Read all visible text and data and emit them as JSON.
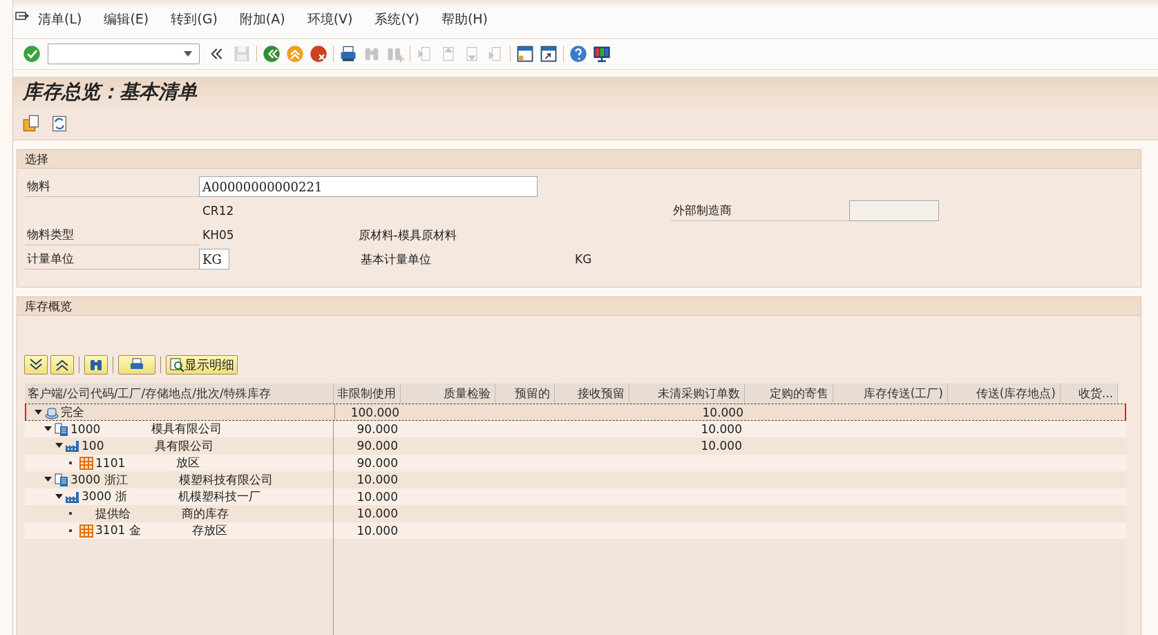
{
  "menu_bar": {
    "items": [
      {
        "label": "清单(L)"
      },
      {
        "label": "编辑(E)"
      },
      {
        "label": "转到(G)"
      },
      {
        "label": "附加(A)"
      },
      {
        "label": "环境(V)"
      },
      {
        "label": "系统(Y)"
      },
      {
        "label": "帮助(H)"
      }
    ]
  },
  "toolbar": {
    "buttons": [
      {
        "kind": "enter",
        "disabled": false
      },
      {
        "kind": "collapse",
        "disabled": false
      },
      {
        "kind": "save",
        "disabled": true
      },
      {
        "kind": "sep"
      },
      {
        "kind": "back",
        "disabled": false
      },
      {
        "kind": "exit",
        "disabled": false
      },
      {
        "kind": "cancel",
        "disabled": false
      },
      {
        "kind": "sep"
      },
      {
        "kind": "print",
        "disabled": false
      },
      {
        "kind": "find",
        "disabled": true
      },
      {
        "kind": "find_next",
        "disabled": true
      },
      {
        "kind": "sep"
      },
      {
        "kind": "first_page",
        "disabled": true
      },
      {
        "kind": "prev_page",
        "disabled": true
      },
      {
        "kind": "next_page",
        "disabled": true
      },
      {
        "kind": "last_page",
        "disabled": true
      },
      {
        "kind": "sep"
      },
      {
        "kind": "new_session",
        "disabled": false
      },
      {
        "kind": "shortcut",
        "disabled": false
      },
      {
        "kind": "sep"
      },
      {
        "kind": "help",
        "disabled": false
      },
      {
        "kind": "layout",
        "disabled": false
      }
    ]
  },
  "title": "库存总览：基本清单",
  "app_toolbar": {
    "buttons": [
      {
        "kind": "folder"
      },
      {
        "kind": "refresh"
      }
    ]
  },
  "selection": {
    "title": "选择",
    "material": {
      "label": "物料",
      "value": "A00000000000221"
    },
    "plant_code": "CR12",
    "external_manufacturer": {
      "label": "外部制造商"
    },
    "material_type": {
      "label": "物料类型",
      "value": "KH05",
      "description": "原材料-模具原材料"
    },
    "unit": {
      "label": "计量单位",
      "value": "KG",
      "base_label": "基本计量单位",
      "base_value": "KG"
    }
  },
  "stock_overview": {
    "title": "库存概览",
    "tools": [
      {
        "kind": "expand"
      },
      {
        "kind": "collapse"
      },
      {
        "kind": "find"
      },
      {
        "kind": "print"
      },
      {
        "kind": "details",
        "label": "显示明细"
      }
    ],
    "columns": [
      "客户端/公司代码/工厂/存储地点/批次/特殊库存",
      "非限制使用",
      "质量检验",
      "预留的",
      "接收预留",
      "未清采购订单数",
      "定购的寄售",
      "库存传送(工厂)",
      "传送(库存地点)",
      "收货..."
    ],
    "tree": [
      {
        "kind": "total",
        "name": "完全",
        "expanded": true,
        "selected": true,
        "unrestricted": "100.000",
        "open_po": "10.000",
        "children": [
          {
            "kind": "company",
            "code": "1000",
            "name": "模具有限公司",
            "expanded": true,
            "selected": false,
            "unrestricted": "90.000",
            "open_po": "10.000",
            "children": [
              {
                "kind": "plant",
                "code": "100",
                "name": "具有限公司",
                "expanded": true,
                "selected": false,
                "unrestricted": "90.000",
                "open_po": "10.000",
                "children": [
                  {
                    "kind": "storage",
                    "code": "1101",
                    "name": "放区",
                    "selected": false,
                    "unrestricted": "90.000"
                  }
                ]
              }
            ]
          },
          {
            "kind": "company",
            "code": "3000 浙江",
            "name": "模塑科技有限公司",
            "expanded": true,
            "selected": false,
            "unrestricted": "10.000",
            "children": [
              {
                "kind": "plant",
                "code": "3000 浙",
                "name": "机模塑科技一厂",
                "expanded": true,
                "selected": false,
                "unrestricted": "10.000",
                "children": [
                  {
                    "kind": "special",
                    "code": "提供给",
                    "name": "商的库存",
                    "selected": false,
                    "unrestricted": "10.000"
                  },
                  {
                    "kind": "storage",
                    "code": "3101 金",
                    "name": "存放区",
                    "selected": false,
                    "unrestricted": "10.000"
                  }
                ]
              }
            ]
          }
        ]
      }
    ]
  }
}
